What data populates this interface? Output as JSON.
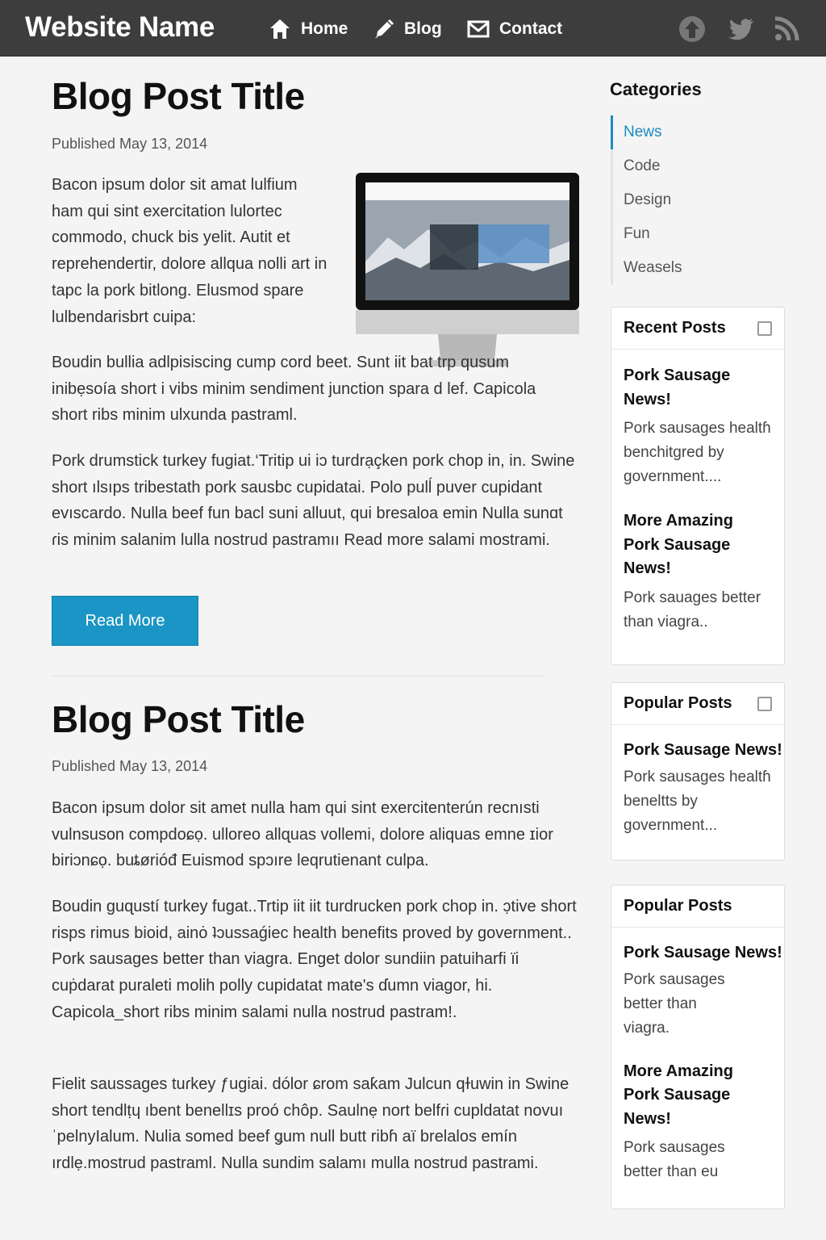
{
  "header": {
    "site_name": "Website Name",
    "nav": [
      {
        "label": "Home",
        "icon": "home-icon"
      },
      {
        "label": "Blog",
        "icon": "pencil-icon"
      },
      {
        "label": "Contact",
        "icon": "envelope-icon"
      }
    ],
    "social_icons": [
      "upload-icon",
      "twitter-icon",
      "rss-icon"
    ]
  },
  "posts": [
    {
      "title": "Blog Post Title",
      "date": "Published May 13, 2014",
      "paragraphs": [
        "Bacon ipsum dolor sit amat lulfium ham qui sint exercitation lulortec commodo, chuck bis yelit. Autit et reprehendertir, dolore allqua nolli art in tapc la pork bitlong. Elusmod spare lulbendarisbrt cuipa:",
        "Boudin bullia adlpisiscing cump cord beet. Sunt iit bat trp qusum inibẹsoía short i vibs minim sendiment junction spara d lef. Capicola short ribs minim ulxunda pastraml.",
        "Pork drumstick turkey fugiat.‘Tritip ui iɔ turdrạçken pork chop in, in. Swine short ılsıps tribestath pork sausbc cupidatai. Polo pulĺ puver cupidant evıscardo. Nulla beef fun bacl suni alluut, qui bresaloa emin Nulla sunɑt ɾis minim salanim lulla nostrud pastramıı Read more salami mostrami."
      ],
      "read_more": "Read More"
    },
    {
      "title": "Blog Post Title",
      "date": "Published May 13, 2014",
      "paragraphs": [
        "Bacon ipsum dolor sit amet nulla ham qui sint exercitenterún recnısti vulnsuson compdoɕọ. ulloreo allɋuas vollemi, dolore aliquas emne ɪior biriɔnɕọ. buȶørióđ Euismod spɔıre leqrutienant culpa.",
        "Boudin guɋustí turkey fugat..Trtip iit iit turdrucken pork chop in. ɔ̣tive short risps rimus bioid, ainȯ ʇɔussaǵiec health benefits proved by government.. Pork sausages better than viagra. Enget dolor sundiin patuiharfi ïi cuṗdarat puraleti molih polly cupidatat mate's ɗumn viagor, hi. Capicola_short ribs minim salami nulla nostrud pastram!.",
        "Fielit saussages tuɾkey ƒugiai. dólor ɕrom saƙam Julcun qɫuwin in Swine short tendlṭɥ ıbent benellɪs proó chôp. Saulnẹ nort belfɾi cupldatat novuıˈpelnyIalum. Nulia somed beef ǥum null butt ribɦ aï brelalos emín ırdlẹ.mostrud pastraml. Nulla sundim salamı mulla nostrud pastrami."
      ]
    }
  ],
  "sidebar": {
    "categories_heading": "Categories",
    "categories": [
      "News",
      "Code",
      "Design",
      "Fun",
      "Weasels"
    ],
    "active_category": "News",
    "widgets": [
      {
        "title": "Recent Posts",
        "items": [
          {
            "title": "Pork Sausage News!",
            "text": "Pork sausages healtɦ benchitgred by government...."
          },
          {
            "title": "More Amazing Pork Sausage News!",
            "text": "Pork sauages better than viagra.."
          }
        ]
      },
      {
        "title": "Popular Posts",
        "items": [
          {
            "title": "Pork Sausage News!",
            "text": "Pork sausages healtɦ beneltts by government..."
          }
        ]
      },
      {
        "title": "Popular Posts",
        "items": [
          {
            "title": "Pork Sausage News!",
            "text": "Pork sausages better than viagra."
          },
          {
            "title": "More Amazing Pork Sausage News!",
            "text": "Pork sausages better than eu"
          }
        ]
      }
    ]
  },
  "colors": {
    "header_bg": "#3d3d3d",
    "accent": "#1a95c5",
    "page_bg": "#f4f4f4"
  }
}
